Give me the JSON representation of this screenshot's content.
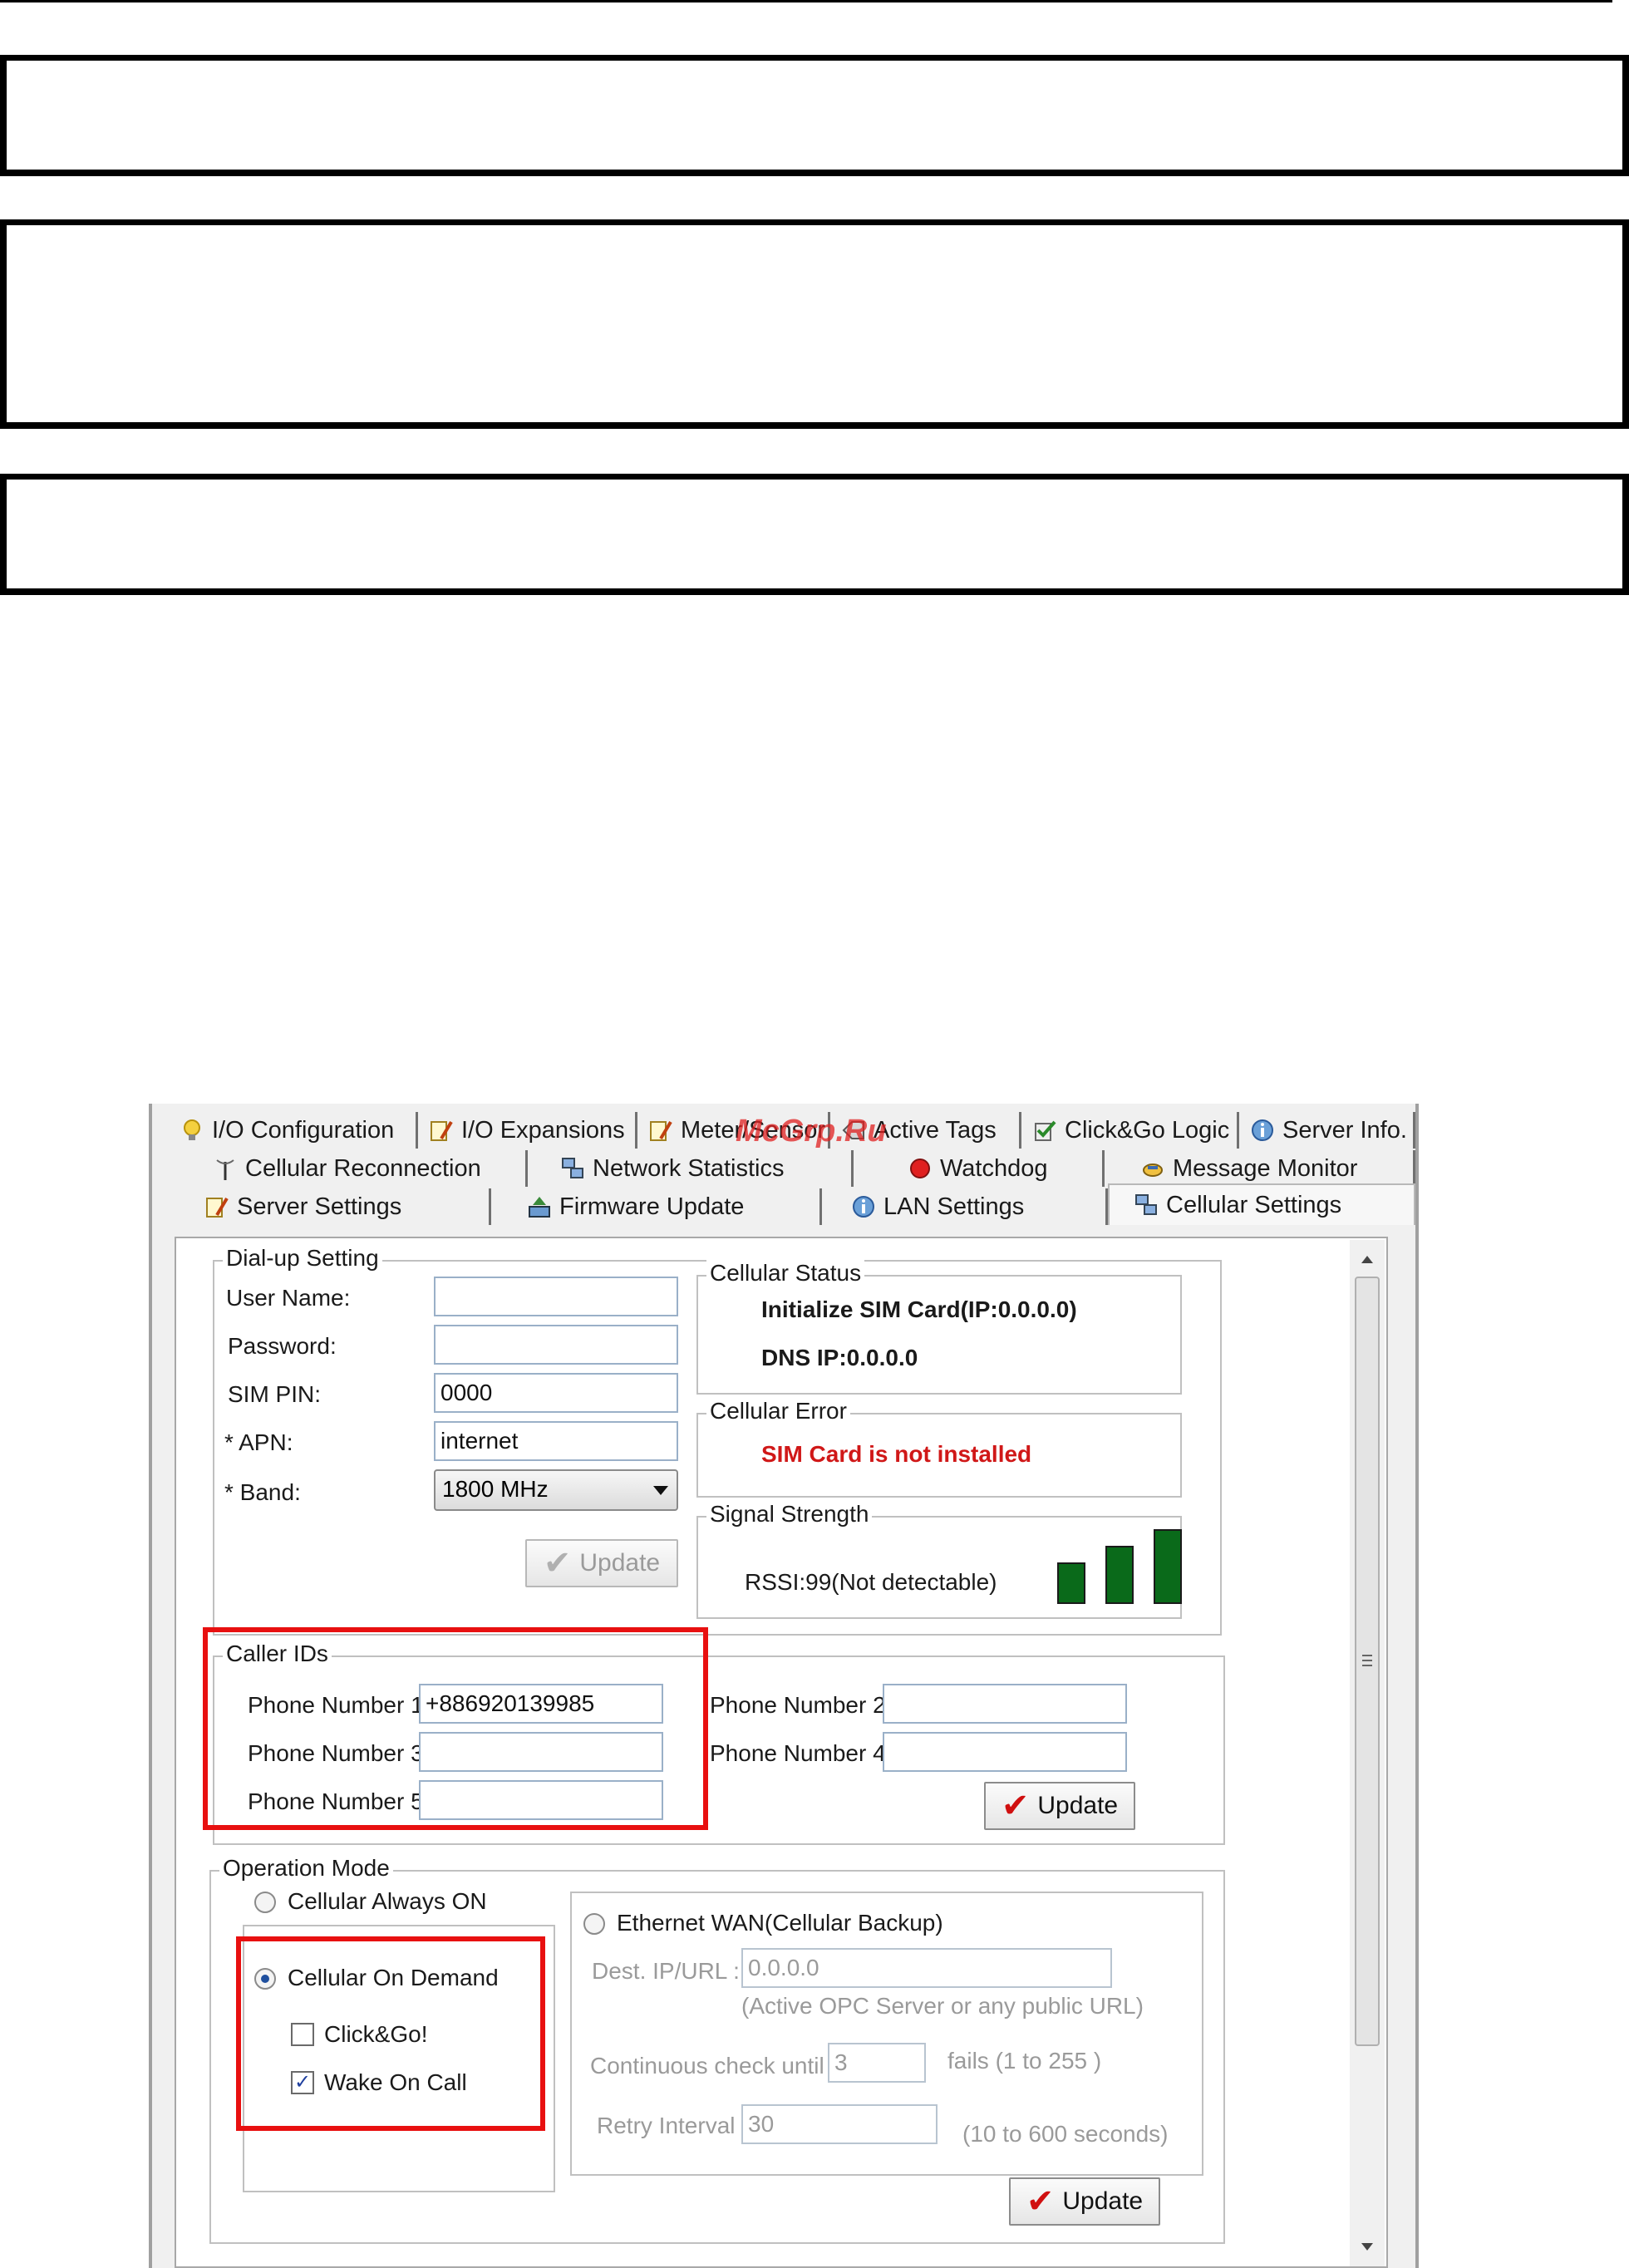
{
  "watermark": "McGrp.Ru",
  "tabs": {
    "row1": [
      "I/O Configuration",
      "I/O Expansions",
      "Meter/Sensor",
      "Active Tags",
      "Click&Go Logic",
      "Server Info."
    ],
    "row2": [
      "Cellular Reconnection",
      "Network Statistics",
      "Watchdog",
      "Message Monitor"
    ],
    "row3": [
      "Server Settings",
      "Firmware Update",
      "LAN Settings",
      "Cellular Settings"
    ],
    "active": "Cellular Settings"
  },
  "dialup": {
    "title": "Dial-up Setting",
    "user_name_label": "User Name:",
    "user_name_value": "",
    "password_label": "Password:",
    "password_value": "",
    "sim_pin_label": "SIM PIN:",
    "sim_pin_value": "0000",
    "apn_label": "* APN:",
    "apn_value": "internet",
    "band_label": "* Band:",
    "band_value": "1800 MHz",
    "update_label": "Update"
  },
  "status": {
    "title": "Cellular Status",
    "line1": "Initialize SIM Card(IP:0.0.0.0)",
    "line2": "DNS IP:0.0.0.0"
  },
  "error": {
    "title": "Cellular Error",
    "message": "SIM Card is not installed"
  },
  "signal": {
    "title": "Signal Strength",
    "rssi": "RSSI:99(Not detectable)",
    "bars": [
      0.55,
      0.78,
      1.0
    ]
  },
  "caller_ids": {
    "title": "Caller IDs",
    "phone1_label": "Phone Number 1:",
    "phone1_value": "+886920139985",
    "phone2_label": "Phone Number 2:",
    "phone2_value": "",
    "phone3_label": "Phone Number 3:",
    "phone3_value": "",
    "phone4_label": "Phone Number 4:",
    "phone4_value": "",
    "phone5_label": "Phone Number 5:",
    "phone5_value": "",
    "update_label": "Update"
  },
  "operation": {
    "title": "Operation Mode",
    "always_on": "Cellular Always ON",
    "always_on_selected": false,
    "on_demand": "Cellular On Demand",
    "on_demand_selected": true,
    "click_go": "Click&Go!",
    "click_go_checked": false,
    "wake_on_call": "Wake On Call",
    "wake_on_call_checked": true,
    "ethernet_wan": "Ethernet WAN(Cellular Backup)",
    "ethernet_wan_selected": false,
    "dest_label": "Dest. IP/URL :",
    "dest_value": "0.0.0.0",
    "dest_hint": "(Active OPC Server or any public URL)",
    "continuous_label": "Continuous check until :",
    "continuous_value": "3",
    "continuous_hint": "fails (1 to 255 )",
    "retry_label": "Retry Interval :",
    "retry_value": "30",
    "retry_hint": "(10 to 600 seconds)",
    "update_label": "Update"
  },
  "colors": {
    "highlight": "#e81010",
    "error_text": "#d01818",
    "signal_bar": "#0a6a1a"
  }
}
